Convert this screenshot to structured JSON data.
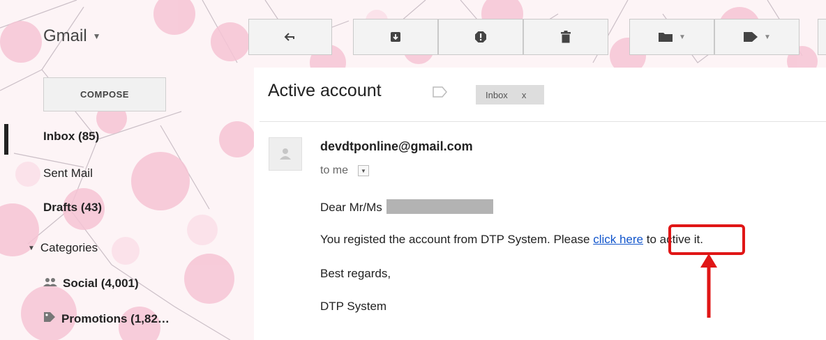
{
  "app": {
    "title": "Gmail"
  },
  "toolbar": {
    "reply_icon": "reply-icon",
    "archive_icon": "archive-icon",
    "spam_icon": "report-spam-icon",
    "delete_icon": "trash-icon",
    "move_icon": "folder-icon",
    "labels_icon": "label-tag-icon"
  },
  "sidebar": {
    "compose_label": "COMPOSE",
    "items": [
      {
        "label": "Inbox (85)",
        "bold": true
      },
      {
        "label": "Sent Mail",
        "bold": false
      },
      {
        "label": "Drafts (43)",
        "bold": true
      },
      {
        "label": "Categories",
        "bold": false
      },
      {
        "label": "Social (4,001)",
        "bold": true,
        "icon": "people-icon"
      },
      {
        "label": "Promotions (1,82…",
        "bold": true,
        "icon": "tag-icon"
      }
    ]
  },
  "email": {
    "subject": "Active account",
    "label_chip": "Inbox",
    "label_chip_close": "x",
    "sender": "devdtponline@gmail.com",
    "recipient": "to me",
    "greeting": "Dear Mr/Ms",
    "line1_before": "You registed the account from DTP System. Please ",
    "link_text": "click here",
    "line1_after": " to active it.",
    "closing": "Best regards,",
    "signature": "DTP System"
  },
  "colors": {
    "link": "#1155cc",
    "highlight": "#e01616",
    "background_pink": "#fdf5f7"
  }
}
